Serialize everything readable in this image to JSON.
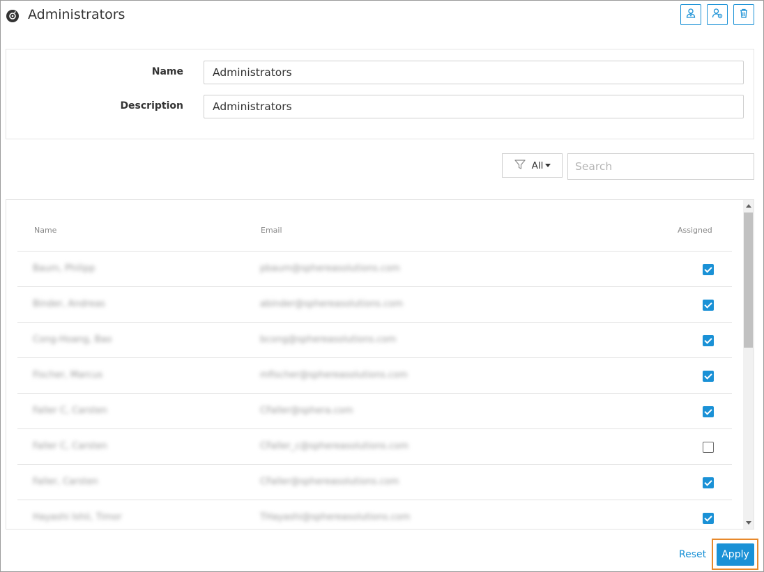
{
  "header": {
    "title": "Administrators",
    "app_icon": "disc-icon",
    "buttons": [
      {
        "icon": "user-group-icon"
      },
      {
        "icon": "user-settings-icon"
      },
      {
        "icon": "trash-icon"
      }
    ]
  },
  "form": {
    "name_label": "Name",
    "name_value": "Administrators",
    "description_label": "Description",
    "description_value": "Administrators"
  },
  "filter": {
    "label": "All",
    "icon": "filter-icon"
  },
  "search": {
    "placeholder": "Search"
  },
  "table": {
    "columns": {
      "name": "Name",
      "email": "Email",
      "assigned": "Assigned"
    },
    "rows": [
      {
        "name": "Baum, Philipp",
        "email": "pbaum@sphereasolutions.com",
        "assigned": true
      },
      {
        "name": "Binder, Andreas",
        "email": "abinder@sphereasolutions.com",
        "assigned": true
      },
      {
        "name": "Cong-Hoang, Bao",
        "email": "bcong@sphereasolutions.com",
        "assigned": true
      },
      {
        "name": "Fischer, Marcus",
        "email": "mfischer@sphereasolutions.com",
        "assigned": true
      },
      {
        "name": "Faller C, Carsten",
        "email": "CFaller@sphera.com",
        "assigned": true
      },
      {
        "name": "Faller C, Carsten",
        "email": "CFaller_c@sphereasolutions.com",
        "assigned": false
      },
      {
        "name": "Faller, Carsten",
        "email": "CFaller@sphereasolutions.com",
        "assigned": true
      },
      {
        "name": "Hayashi Ishii, Timor",
        "email": "THayashi@sphereasolutions.com",
        "assigned": true
      }
    ]
  },
  "footer": {
    "reset_label": "Reset",
    "apply_label": "Apply"
  },
  "colors": {
    "accent": "#1a91d6",
    "highlight": "#e8892b"
  }
}
